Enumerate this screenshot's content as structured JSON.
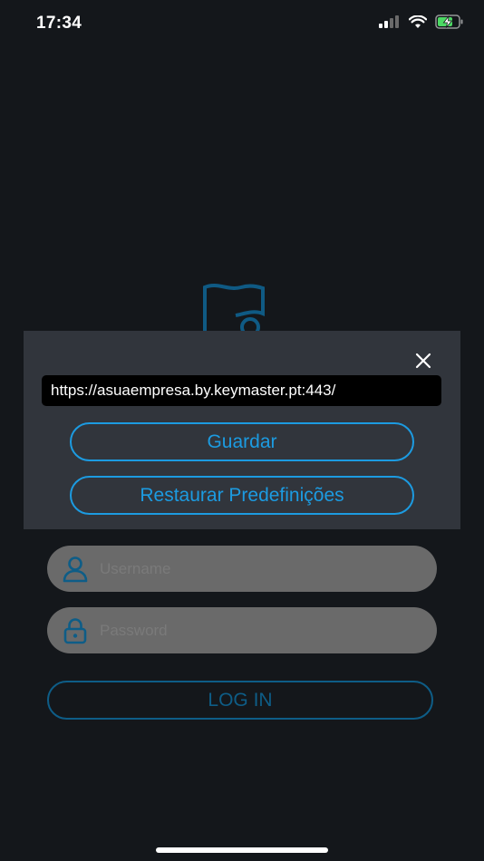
{
  "status_bar": {
    "time": "17:34",
    "icons": [
      "cellular-signal-icon",
      "wifi-icon",
      "battery-charging-icon"
    ],
    "battery_color": "#4cd964"
  },
  "app": {
    "logo_icon": "flag-logo-icon",
    "accent_color": "#1c9be1",
    "login": {
      "username_placeholder": "Username",
      "password_placeholder": "Password",
      "login_label": "LOG IN"
    }
  },
  "dialog": {
    "url_value": "https://asuaempresa.by.keymaster.pt:443/",
    "save_label": "Guardar",
    "restore_label": "Restaurar Predefinições",
    "close_icon": "close-icon"
  }
}
